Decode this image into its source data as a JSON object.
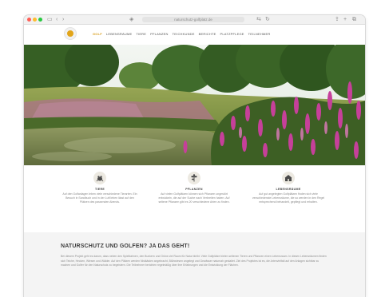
{
  "browser": {
    "url": "naturschutz-golfplatz.de",
    "traffic_lights": [
      "#ff5f57",
      "#febc2e",
      "#28c840"
    ]
  },
  "site_nav": {
    "accent_color": "#d9a020",
    "items": [
      {
        "label": "GOLF"
      },
      {
        "label": "LEBENSRÄUME"
      },
      {
        "label": "TIERE"
      },
      {
        "label": "PFLANZEN"
      },
      {
        "label": "TEICHKUNDE"
      },
      {
        "label": "BERICHTE"
      },
      {
        "label": "PLATZPFLEGE"
      },
      {
        "label": "TEILNEHMER"
      }
    ]
  },
  "features": [
    {
      "icon": "frog-icon",
      "title": "TIERE",
      "text": "Auf den Golfanlagen leben viele verschiedene Tierarten. Ein Besuch in Sandbuch und in der Luft leben lässt auf den Plätzen des passenden Abends."
    },
    {
      "icon": "plant-icon",
      "title": "PFLANZEN",
      "text": "Auf vielen Golfplätzen können sich Pflanzen ungestört entwickeln, die auf der Suche nach Verbreiten haben. Auf seltene Pflanzen gibt es 20 verschiedene Arten zu finden."
    },
    {
      "icon": "habitat-icon",
      "title": "LEBENSRÄUME",
      "text": "Auf gut angelegten Golfplätzen finden sich viele verschiedenste Lebensräume, die so werden in den Regel entsprechend behandelt, gepflegt und erhalten."
    }
  ],
  "golf_section": {
    "heading": "NATURSCHUTZ UND GOLFEN? JA DAS GEHT!",
    "text": "Bei diesem Projekt geht es darum, dass neben den Spielbahnen, den Bunkern und Grüns viel Raum für Natur bleibt. Viele Golfplätze bieten seltenen Tieren und Pflanzen einen Lebensraum. In diesen Lebensräumen finden sich Teiche, Hecken, Wiesen und Wälder. Auf den Plätzen werden Nistkästen angebracht, Blühwiesen angelegt und Gewässer naturnah gestaltet. Ziel des Projektes ist es, die Artenvielfalt auf den Anlagen sichtbar zu machen und Golfer für den Naturschutz zu begeistern. Die Teilnehmer berichten regelmäßig über ihre Erfahrungen und die Entwicklung der Flächen."
  }
}
